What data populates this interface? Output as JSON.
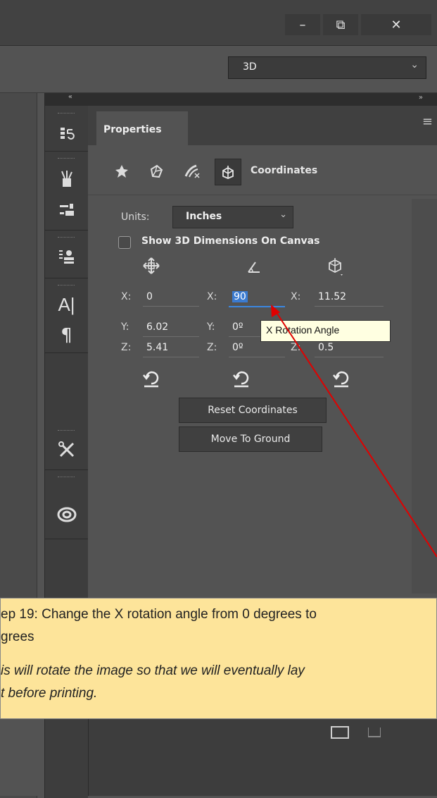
{
  "window": {
    "minimize_glyph": "–",
    "restore_glyph": "⧉",
    "close_glyph": "✕"
  },
  "options_bar": {
    "workspace_value": "3D"
  },
  "panel": {
    "collapse_left": "«",
    "collapse_right": "»",
    "tab_label": "Properties",
    "menu_icon": "hamburger-icon",
    "section_label": "Coordinates"
  },
  "coordinates": {
    "units_label": "Units:",
    "units_value": "Inches",
    "show_dimensions_label": "Show 3D Dimensions On Canvas",
    "show_dimensions_checked": false,
    "position": {
      "x_label": "X:",
      "x": "0",
      "y_label": "Y:",
      "y": "6.02",
      "z_label": "Z:",
      "z": "5.41"
    },
    "rotation": {
      "x_label": "X:",
      "x": "90",
      "y_label": "Y:",
      "y": "0º",
      "z_label": "Z:",
      "z": "0º"
    },
    "scale": {
      "x_label": "X:",
      "x": "11.52",
      "z_label": "Z:",
      "z": "0.5"
    },
    "tooltip": "X Rotation Angle",
    "reset_button": "Reset Coordinates",
    "ground_button": "Move To Ground"
  },
  "callout": {
    "line1": "ep 19: Change the X rotation angle from 0 degrees to",
    "line2": "grees",
    "line3": "is will rotate the image so that we will eventually lay",
    "line4": "t before printing.",
    "bg_color": "#fde49a",
    "arrow_color": "#e00000"
  }
}
